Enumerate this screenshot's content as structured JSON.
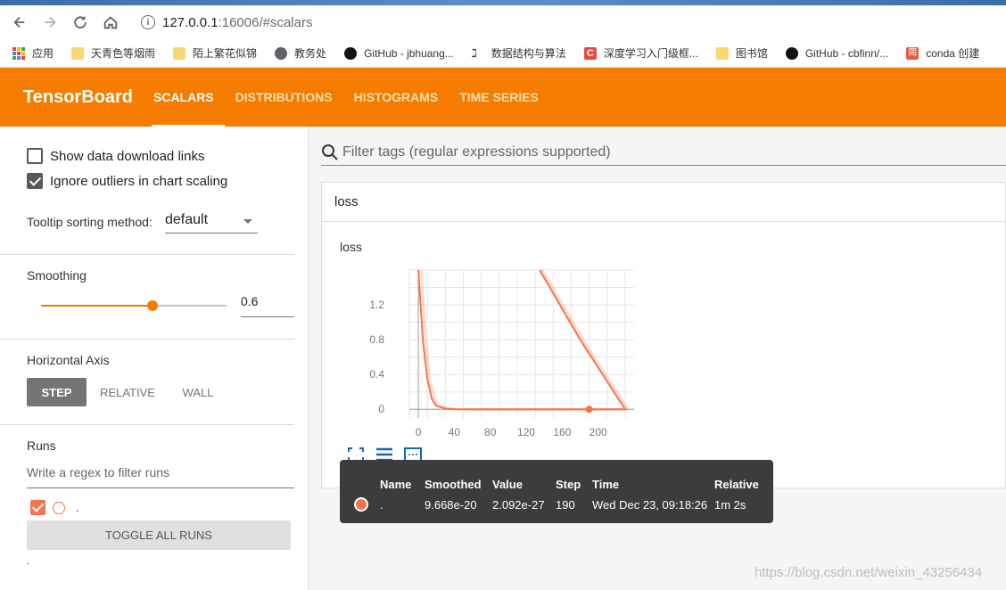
{
  "browser": {
    "url_host": "127.0.0.1",
    "url_rest": ":16006/#scalars",
    "bookmarks": [
      {
        "label": "应用",
        "icon": "apps-icon"
      },
      {
        "label": "天青色等烟雨",
        "icon": "folder-icon"
      },
      {
        "label": "陌上繁花似锦",
        "icon": "folder-icon"
      },
      {
        "label": "教务处",
        "icon": "globe-icon"
      },
      {
        "label": "GitHub - jbhuang...",
        "icon": "github-icon"
      },
      {
        "label": "数据结构与算法",
        "icon": "algorithm-icon"
      },
      {
        "label": "深度学习入门级框...",
        "icon": "csdn-icon"
      },
      {
        "label": "图书馆",
        "icon": "folder-icon"
      },
      {
        "label": "GitHub - cbfinn/...",
        "icon": "github-icon"
      },
      {
        "label": "conda 创建",
        "icon": "jian-icon"
      }
    ]
  },
  "header": {
    "title": "TensorBoard",
    "tabs": [
      {
        "label": "SCALARS",
        "active": true
      },
      {
        "label": "DISTRIBUTIONS",
        "active": false
      },
      {
        "label": "HISTOGRAMS",
        "active": false
      },
      {
        "label": "TIME SERIES",
        "active": false
      }
    ],
    "accent": "#f57c00"
  },
  "sidebar": {
    "show_download_links": {
      "label": "Show data download links",
      "checked": false
    },
    "ignore_outliers": {
      "label": "Ignore outliers in chart scaling",
      "checked": true
    },
    "tooltip_sorting_label": "Tooltip sorting method:",
    "tooltip_sorting_value": "default",
    "smoothing_label": "Smoothing",
    "smoothing_value": "0.6",
    "smoothing_fraction": 0.6,
    "horizontal_axis_label": "Horizontal Axis",
    "axis_options": [
      "STEP",
      "RELATIVE",
      "WALL"
    ],
    "axis_selected": "STEP",
    "runs_label": "Runs",
    "runs_filter_placeholder": "Write a regex to filter runs",
    "run_name": ".",
    "toggle_all_label": "TOGGLE ALL RUNS",
    "footer_text": "."
  },
  "main": {
    "filter_placeholder": "Filter tags (regular expressions supported)",
    "card_header": "loss",
    "chart_title": "loss",
    "tooltip": {
      "headers": [
        "Name",
        "Smoothed",
        "Value",
        "Step",
        "Time",
        "Relative"
      ],
      "values": [
        ".",
        "9.668e-20",
        "2.092e-27",
        "190",
        "Wed Dec 23, 09:18:26",
        "1m 2s"
      ],
      "run_color": "#f4754d"
    }
  },
  "chart_data": {
    "type": "line",
    "title": "loss",
    "xlabel": "",
    "ylabel": "",
    "x_ticks": [
      0,
      40,
      80,
      120,
      160,
      200
    ],
    "y_ticks": [
      0,
      0.4,
      0.8,
      1.2
    ],
    "xlim": [
      -10,
      240
    ],
    "ylim": [
      -0.1,
      1.6
    ],
    "grid": true,
    "series": [
      {
        "color": "#f4754d",
        "x": [
          0,
          5,
          10,
          15,
          20,
          30,
          40,
          60,
          100,
          150,
          190,
          230
        ],
        "y": [
          1.6,
          0.8,
          0.35,
          0.12,
          0.04,
          0.008,
          0.001,
          0.0,
          0.0,
          0.0,
          0.0,
          0.0
        ]
      },
      {
        "color": "#f4754d",
        "x": [
          135,
          180,
          230
        ],
        "y": [
          1.6,
          0.8,
          0.0
        ]
      }
    ],
    "highlight": {
      "x": 190,
      "y": 0.0
    }
  },
  "watermark": "https://blog.csdn.net/weixin_43256434"
}
